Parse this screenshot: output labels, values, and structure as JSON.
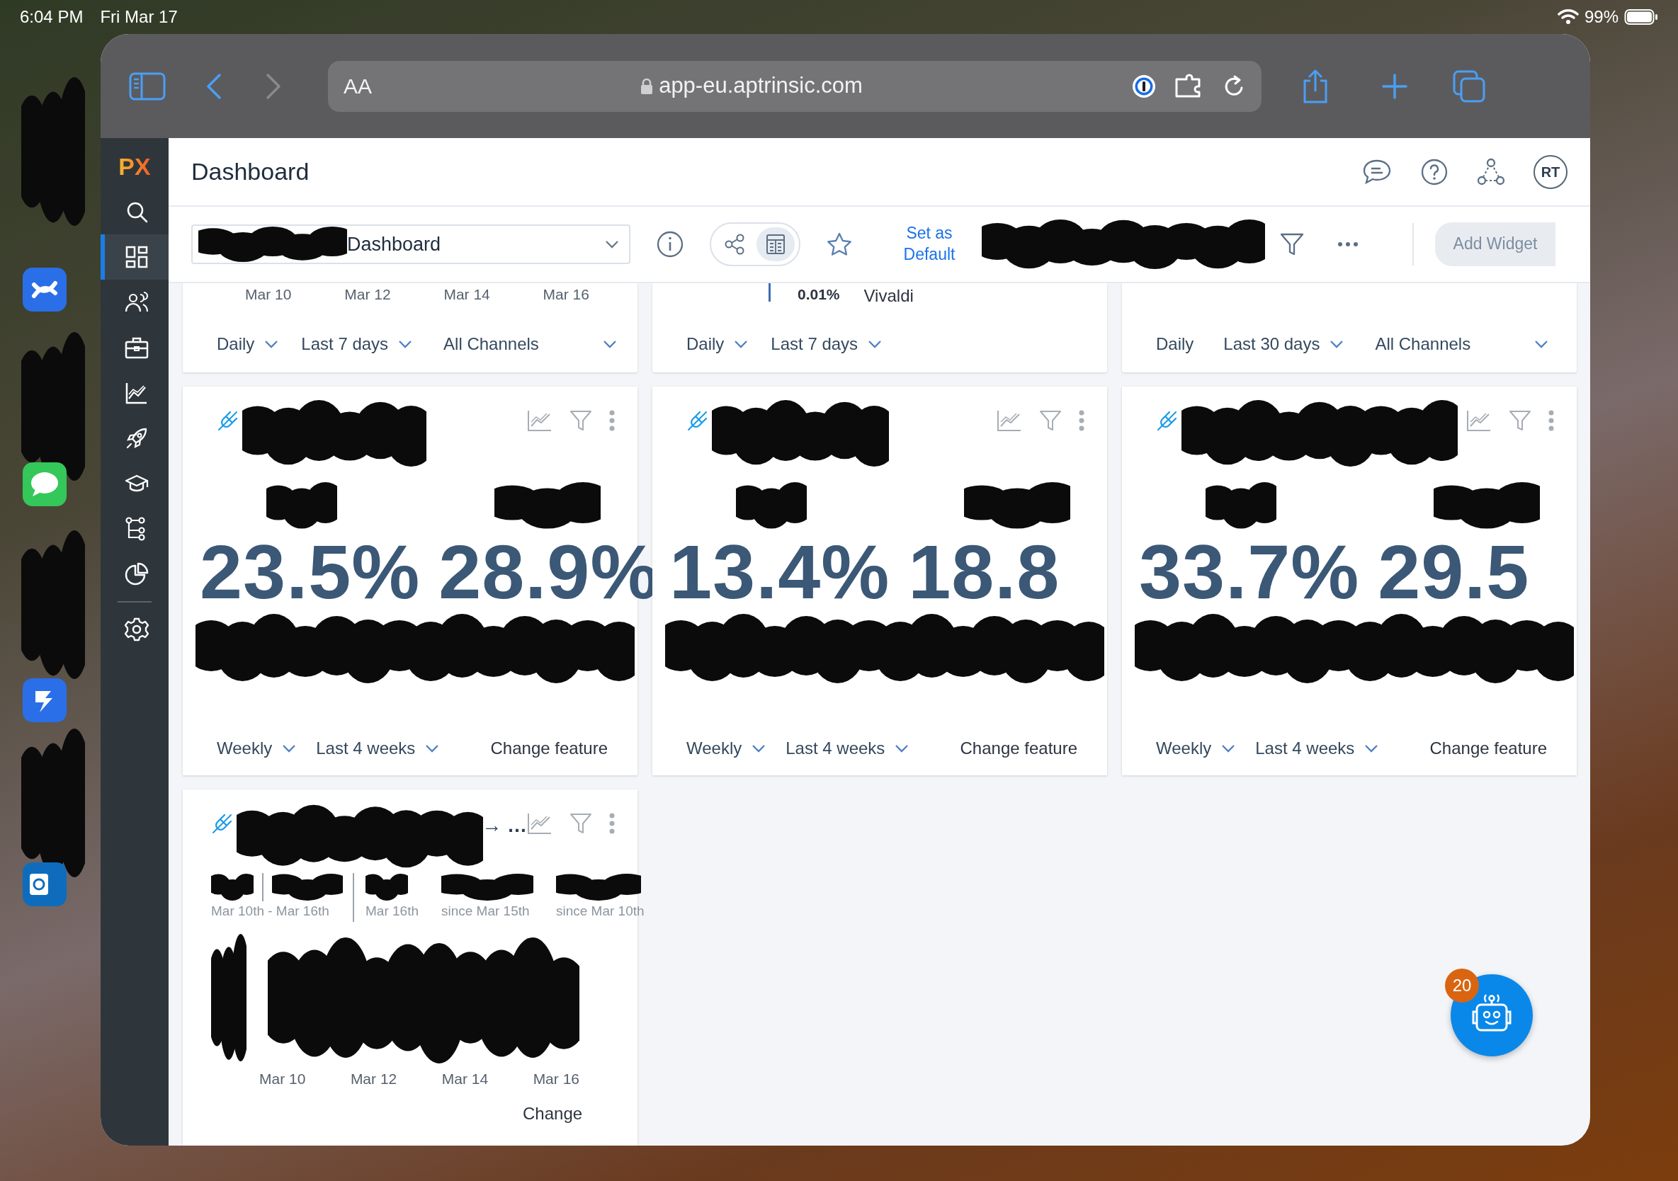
{
  "status_bar": {
    "time": "6:04 PM",
    "date": "Fri Mar 17",
    "battery": "99%"
  },
  "browser": {
    "text_size": "AA",
    "url": "app-eu.aptrinsic.com",
    "forward_disabled": true
  },
  "app": {
    "logo": "PX",
    "title": "Dashboard",
    "avatar": "RT",
    "nav": [
      {
        "selected": false
      },
      {
        "selected": true
      },
      {
        "selected": false
      },
      {
        "selected": false
      },
      {
        "selected": false
      },
      {
        "selected": false
      },
      {
        "selected": false
      },
      {
        "selected": false
      },
      {
        "selected": false
      },
      {
        "selected": false
      }
    ]
  },
  "toolbar": {
    "dashboard": "Dashboard",
    "view_toggle": [
      {
        "selected": false
      },
      {
        "selected": true
      }
    ],
    "set_default": "Set as Default",
    "add_widget": {
      "label": "Add Widget",
      "disabled": true
    }
  },
  "top_cards": [
    {
      "axis_labels": [
        "Mar 10",
        "Mar 12",
        "Mar 14",
        "Mar 16"
      ],
      "controls": [
        {
          "label": "Daily",
          "dropdown": true
        },
        {
          "label": "Last 7 days",
          "dropdown": true
        },
        {
          "label": "All Channels",
          "dropdown": true
        }
      ]
    },
    {
      "reading": "0.01%",
      "legend": "Vivaldi",
      "controls": [
        {
          "label": "Daily",
          "dropdown": true
        },
        {
          "label": "Last 7 days",
          "dropdown": true
        }
      ]
    },
    {
      "controls": [
        {
          "label": "Daily",
          "dropdown": false
        },
        {
          "label": "Last 30 days",
          "dropdown": true
        },
        {
          "label": "All Channels",
          "dropdown": true
        }
      ]
    }
  ],
  "metric_cards": [
    {
      "values": [
        "23.5%",
        "28.9%"
      ],
      "controls": [
        {
          "label": "Weekly",
          "dropdown": true
        },
        {
          "label": "Last 4 weeks",
          "dropdown": true
        }
      ],
      "action": "Change feature"
    },
    {
      "values": [
        "13.4%",
        "18.8"
      ],
      "controls": [
        {
          "label": "Weekly",
          "dropdown": true
        },
        {
          "label": "Last 4 weeks",
          "dropdown": true
        }
      ],
      "action": "Change feature"
    },
    {
      "values": [
        "33.7%",
        "29.5"
      ],
      "controls": [
        {
          "label": "Weekly",
          "dropdown": true
        },
        {
          "label": "Last 4 weeks",
          "dropdown": true
        }
      ],
      "action": "Change feature"
    }
  ],
  "trend_card": {
    "title_tail": "→ …",
    "stats": [
      {
        "caption": "Mar 10th - Mar 16th",
        "divider_after": true
      },
      {
        "caption": "Mar 16th",
        "divider_after": false
      },
      {
        "caption": "since Mar 15th",
        "divider_after": false
      },
      {
        "caption": "since Mar 10th",
        "divider_after": false
      }
    ],
    "axis_labels": [
      "Mar 10",
      "Mar 12",
      "Mar 14",
      "Mar 16"
    ],
    "action": "Change"
  },
  "assistant": {
    "badge": "20"
  }
}
